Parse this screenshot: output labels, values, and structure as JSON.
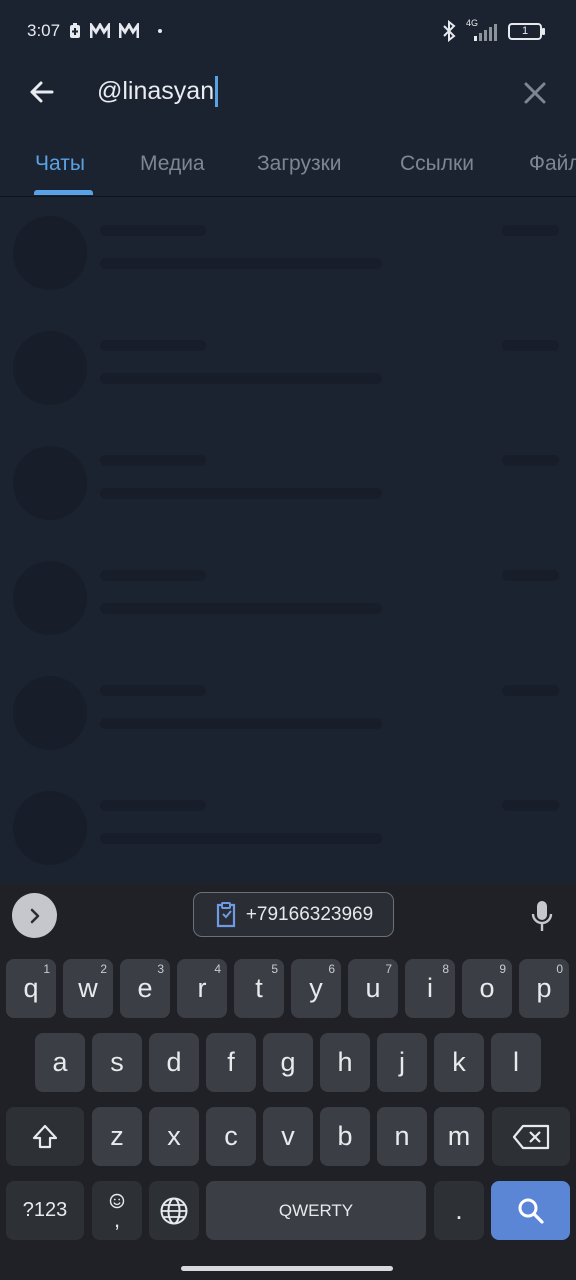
{
  "status_bar": {
    "time": "3:07",
    "network": "4G",
    "battery": "1"
  },
  "search": {
    "query": "@linasyan"
  },
  "tabs": [
    {
      "label": "Чаты",
      "active": true
    },
    {
      "label": "Медиа",
      "active": false
    },
    {
      "label": "Загрузки",
      "active": false
    },
    {
      "label": "Ссылки",
      "active": false
    },
    {
      "label": "Файлы",
      "active": false
    }
  ],
  "list": {
    "state": "loading",
    "skeleton_rows": 6
  },
  "keyboard": {
    "clipboard_suggestion": "+79166323969",
    "row1": [
      {
        "k": "q",
        "h": "1"
      },
      {
        "k": "w",
        "h": "2"
      },
      {
        "k": "e",
        "h": "3"
      },
      {
        "k": "r",
        "h": "4"
      },
      {
        "k": "t",
        "h": "5"
      },
      {
        "k": "y",
        "h": "6"
      },
      {
        "k": "u",
        "h": "7"
      },
      {
        "k": "i",
        "h": "8"
      },
      {
        "k": "o",
        "h": "9"
      },
      {
        "k": "p",
        "h": "0"
      }
    ],
    "row2": [
      "a",
      "s",
      "d",
      "f",
      "g",
      "h",
      "j",
      "k",
      "l"
    ],
    "row3": [
      "z",
      "x",
      "c",
      "v",
      "b",
      "n",
      "m"
    ],
    "symbols_label": "?123",
    "emoji_comma": ",",
    "space_label": "QWERTY",
    "period": "."
  },
  "colors": {
    "background": "#1b2230",
    "accent": "#5aa2e6",
    "keyboard_bg": "#1f2126",
    "key_bg": "#3b3e44",
    "search_key": "#5b86d6"
  }
}
